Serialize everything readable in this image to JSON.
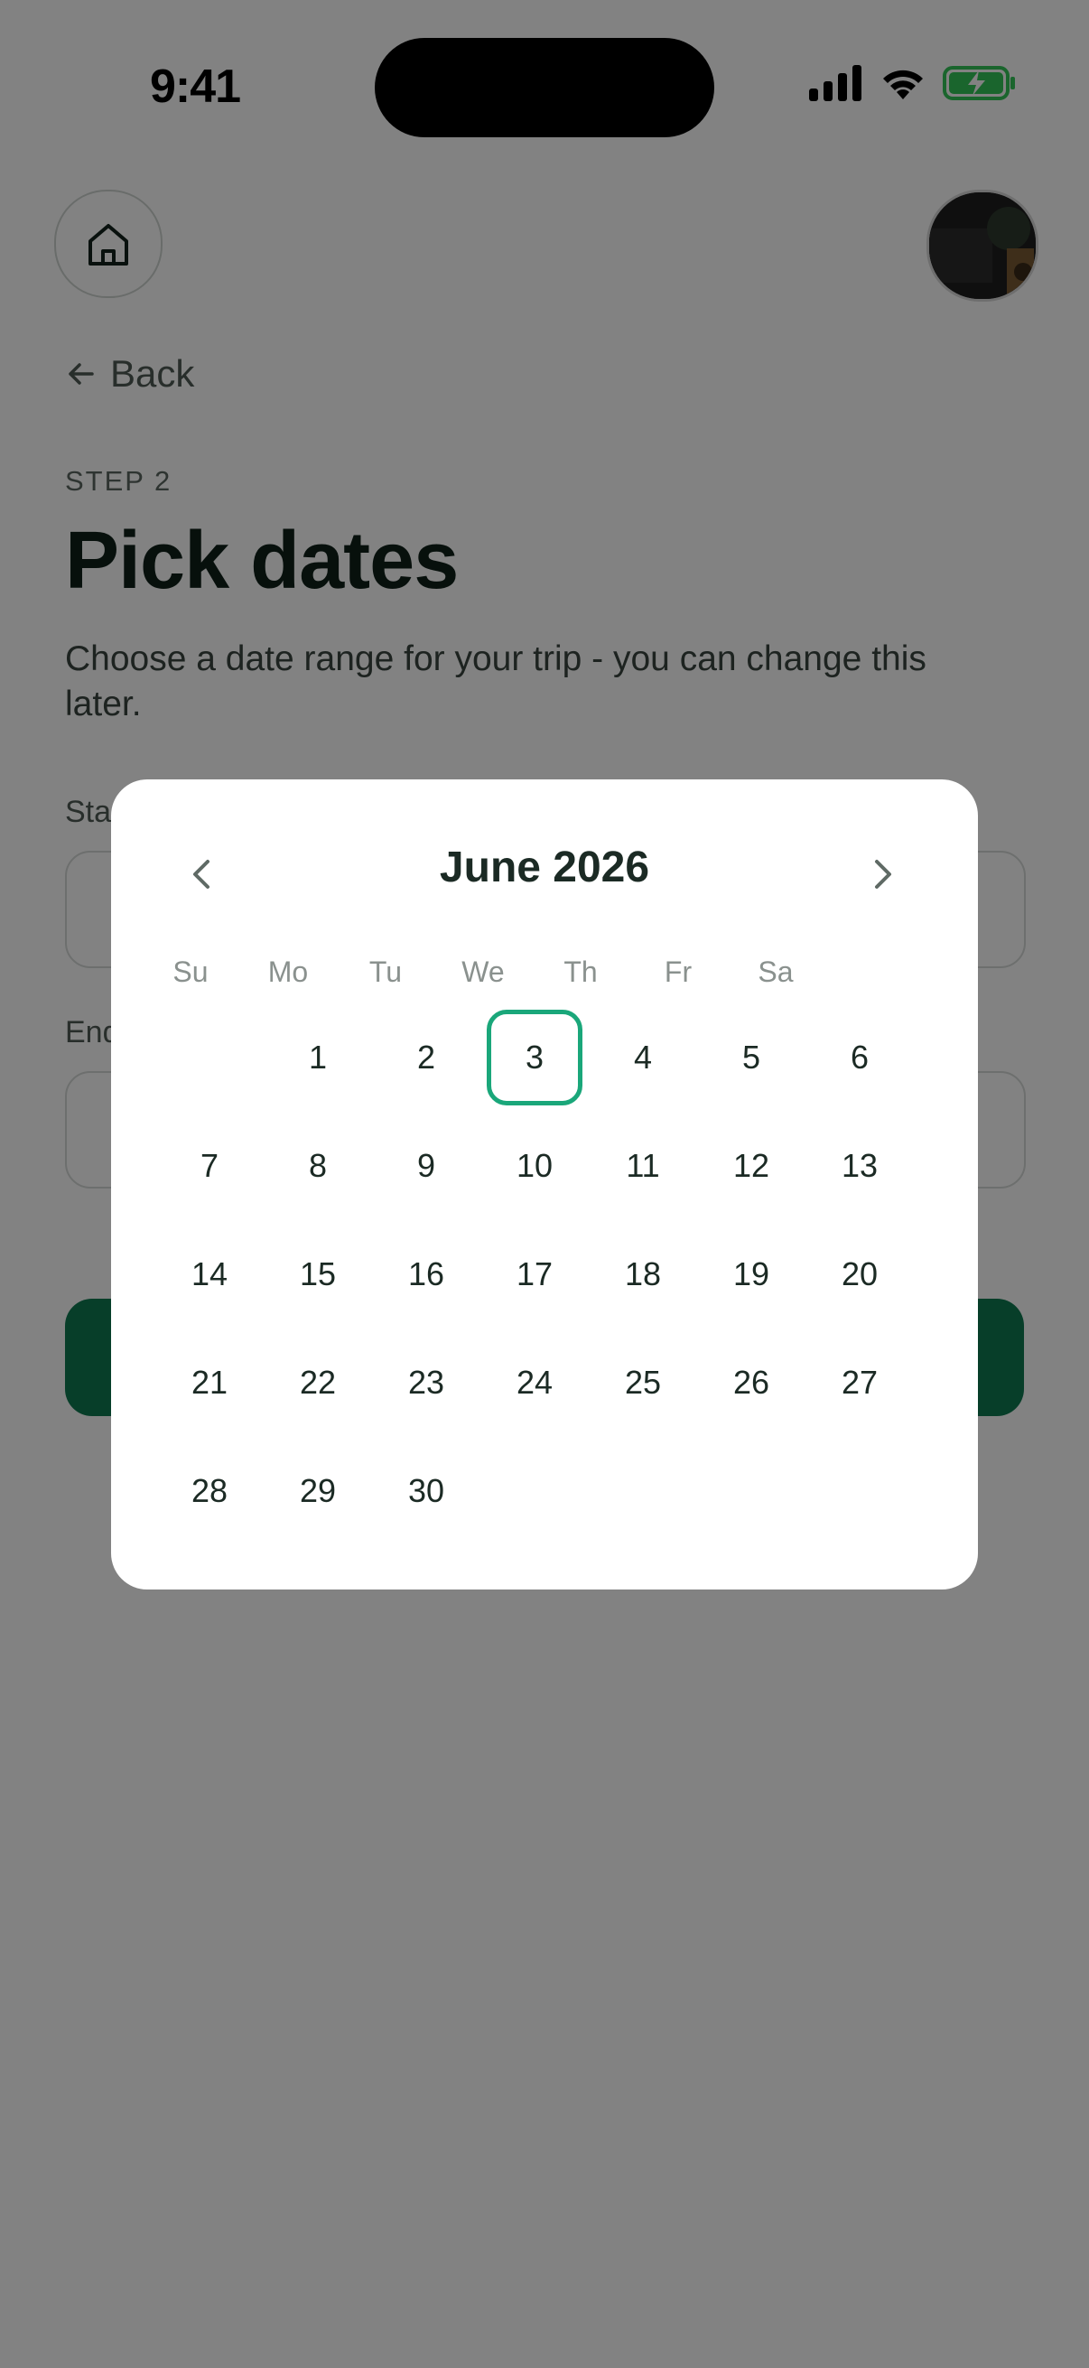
{
  "status_bar": {
    "time": "9:41"
  },
  "header": {
    "avatar_alt": "Profile photo"
  },
  "nav": {
    "back_label": "Back"
  },
  "page": {
    "step": "STEP 2",
    "title": "Pick dates",
    "subtitle": "Choose a date range for your trip - you can change this later."
  },
  "form": {
    "start_label": "Sta",
    "end_label": "End"
  },
  "calendar": {
    "month_label": "June 2026",
    "weekdays": [
      "Su",
      "Mo",
      "Tu",
      "We",
      "Th",
      "Fr",
      "Sa"
    ],
    "first_weekday_index": 1,
    "days_in_month": 30,
    "selected_day": 3
  },
  "colors": {
    "accent": "#1aa77a",
    "primary_button": "#0f7a52",
    "battery": "#34c759"
  }
}
